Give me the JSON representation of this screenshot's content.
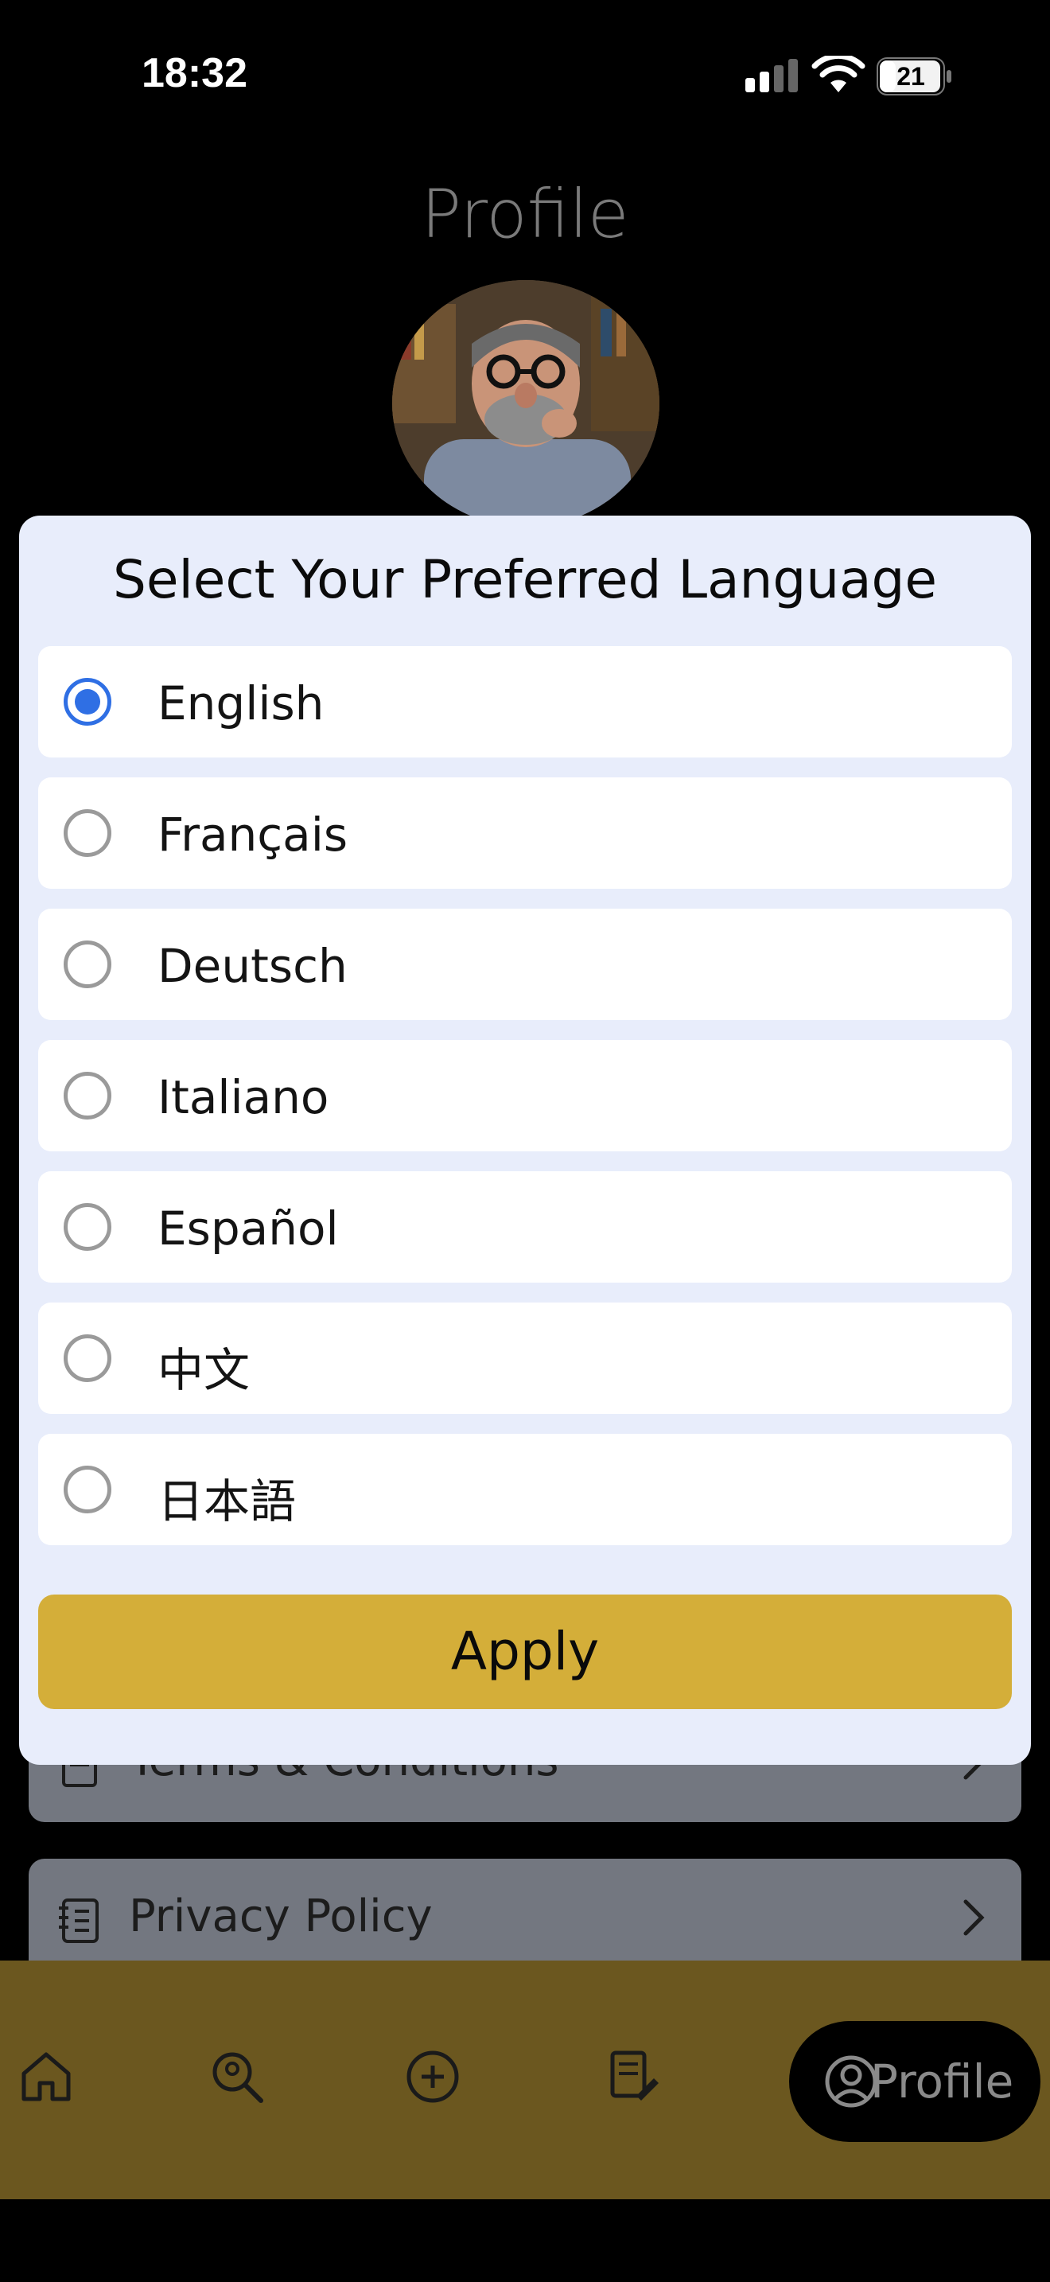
{
  "status_bar": {
    "time": "18:32",
    "battery": "21",
    "icons": [
      "signal-icon",
      "wifi-icon",
      "battery-icon"
    ]
  },
  "page": {
    "title": "Profile",
    "menu_items": [
      {
        "label": "Terms & Conditions",
        "icon": "document-icon"
      },
      {
        "label": "Privacy Policy",
        "icon": "notebook-icon"
      }
    ]
  },
  "modal": {
    "title": "Select Your Preferred Language",
    "options": [
      {
        "label": "English",
        "selected": true
      },
      {
        "label": "Français",
        "selected": false
      },
      {
        "label": "Deutsch",
        "selected": false
      },
      {
        "label": "Italiano",
        "selected": false
      },
      {
        "label": "Español",
        "selected": false
      },
      {
        "label": "中文",
        "selected": false
      },
      {
        "label": "日本語",
        "selected": false
      }
    ],
    "apply_label": "Apply"
  },
  "bottom_nav": {
    "items": [
      "home-icon",
      "search-icon",
      "add-icon",
      "document-edit-icon"
    ],
    "active_label": "Profile"
  },
  "colors": {
    "accent_yellow": "#d4ae39",
    "radio_selected": "#2f6fe4",
    "modal_bg": "#e8edfb"
  }
}
